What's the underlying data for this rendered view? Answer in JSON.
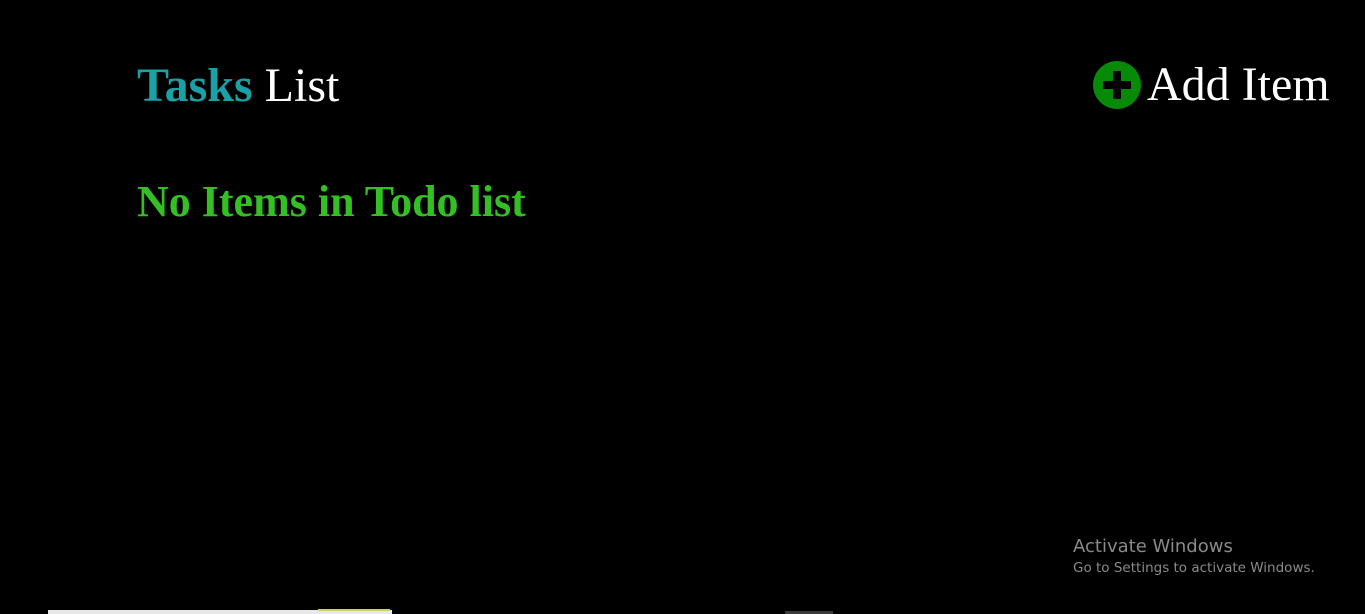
{
  "header": {
    "title_accent": "Tasks",
    "title_main": "List",
    "add_button_label": "Add Item",
    "add_button_icon": "plus-circle-icon"
  },
  "main": {
    "empty_message": "No Items in Todo list"
  },
  "watermark": {
    "title": "Activate Windows",
    "subtitle": "Go to Settings to activate Windows."
  },
  "colors": {
    "background": "#000000",
    "title_accent": "#19a1a6",
    "title_main": "#ffffff",
    "add_icon": "#078a07",
    "empty_message": "#34c025",
    "watermark": "#8a8a8a"
  }
}
